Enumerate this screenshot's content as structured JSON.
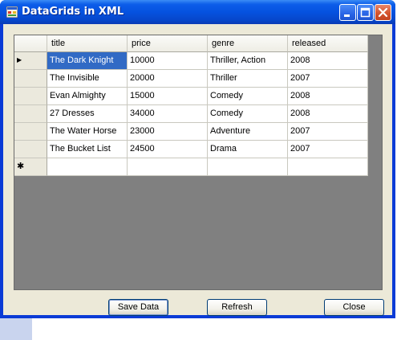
{
  "window": {
    "title": "DataGrids in XML"
  },
  "grid": {
    "columns": [
      "title",
      "price",
      "genre",
      "released"
    ],
    "rows": [
      [
        "The Dark Knight",
        " 10000",
        "Thriller, Action",
        "2008"
      ],
      [
        "The Invisible",
        " 20000",
        "Thriller",
        "2007"
      ],
      [
        "Evan Almighty",
        "15000",
        "Comedy",
        "2008"
      ],
      [
        "27 Dresses",
        "34000",
        "Comedy",
        "2008"
      ],
      [
        "The Water Horse",
        "23000",
        "Adventure",
        "2007"
      ],
      [
        "The Bucket List",
        "24500",
        "Drama",
        "2007"
      ]
    ],
    "current_row_marker": "▶",
    "new_row_marker": "✱"
  },
  "buttons": {
    "save": "Save Data",
    "refresh": "Refresh",
    "close": "Close"
  },
  "colors": {
    "selection": "#316ac5",
    "titlebar": "#0552e0",
    "close_button": "#d5542f",
    "client_bg": "#ece9d8",
    "grid_bg": "#808080"
  },
  "icons": {
    "app": "app-icon",
    "minimize": "minimize-icon",
    "maximize": "maximize-icon",
    "close": "close-icon"
  }
}
